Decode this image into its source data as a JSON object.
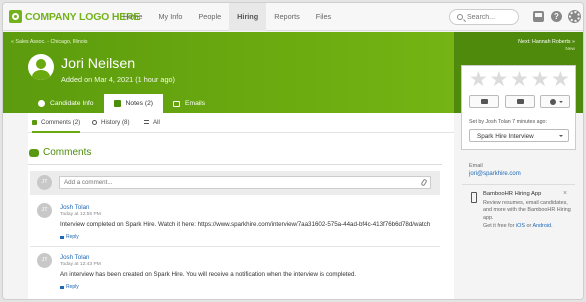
{
  "topnav": {
    "logo": "COMPANY LOGO HERE",
    "items": [
      "Home",
      "My Info",
      "People",
      "Hiring",
      "Reports",
      "Files"
    ],
    "active": "Hiring",
    "search_placeholder": "Search...",
    "help_glyph": "?"
  },
  "header": {
    "breadcrumb": "« Sales Assoc. - Chicago, Illinois",
    "name": "Jori Neilsen",
    "added": "Added on Mar 4, 2021 (1 hour ago)",
    "tabs": [
      "Candidate Info",
      "Notes (2)",
      "Emails"
    ],
    "active_tab": "Notes (2)"
  },
  "next": {
    "label": "Next: Hannah Roberts »",
    "badge": "New"
  },
  "rating": {
    "stars": 5,
    "star_glyph": "★",
    "filled": 0,
    "set_by": "Set by Josh Tolan 7 minutes ago:",
    "selected": "Spark Hire Interview"
  },
  "contact": {
    "email_label": "Email",
    "email": "jori@sparkhire.com"
  },
  "app_promo": {
    "title": "BambooHR Hiring App",
    "description": "Review resumes, email candidates, and more with the BambooHR Hiring app.",
    "link_prefix": "Get it free for ",
    "ios": "iOS",
    "or": " or ",
    "android": "Android",
    "period": ".",
    "close": "×"
  },
  "subtabs": {
    "comments": "Comments (2)",
    "history": "History (8)",
    "all": "All"
  },
  "comments": {
    "title": "Comments",
    "placeholder": "Add a comment...",
    "avatar_initials": "JT",
    "reply_label": "Reply",
    "items": [
      {
        "author": "Josh Tolan",
        "time": "Today at 12:55 PM",
        "text": "Interview completed on Spark Hire. Watch it here: https://www.sparkhire.com/interview/7aa31602-575a-44ad-bf4c-413f76b6d78d/watch"
      },
      {
        "author": "Josh Tolan",
        "time": "Today at 12:43 PM",
        "text": "An interview has been created on Spark Hire. You will receive a notification when the interview is completed."
      }
    ]
  }
}
